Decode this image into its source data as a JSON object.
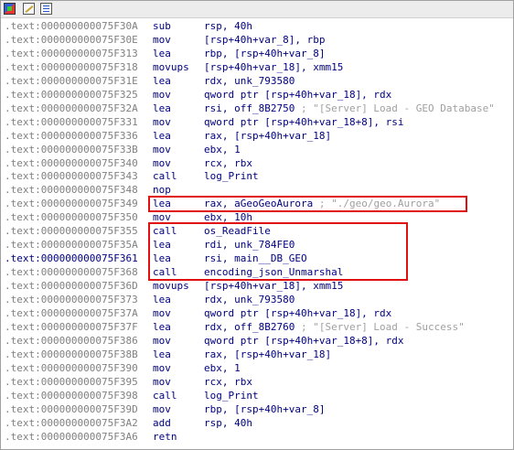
{
  "toolbar": {
    "icons": [
      "graph-view-icon",
      "edit-icon",
      "settings-icon"
    ]
  },
  "colors": {
    "address": "#808080",
    "current_address": "#000080",
    "mnemonic": "#000080",
    "comment": "#a0a0a0",
    "highlight_box": "#e01010"
  },
  "lines": [
    {
      "addr": ".text:000000000075F30A",
      "mn": "sub",
      "ops": "rsp, 40h",
      "cmt": ""
    },
    {
      "addr": ".text:000000000075F30E",
      "mn": "mov",
      "ops": "[rsp+40h+var_8], rbp",
      "cmt": ""
    },
    {
      "addr": ".text:000000000075F313",
      "mn": "lea",
      "ops": "rbp, [rsp+40h+var_8]",
      "cmt": ""
    },
    {
      "addr": ".text:000000000075F318",
      "mn": "movups",
      "ops": "[rsp+40h+var_18], xmm15",
      "cmt": ""
    },
    {
      "addr": ".text:000000000075F31E",
      "mn": "lea",
      "ops": "rdx, unk_793580",
      "cmt": ""
    },
    {
      "addr": ".text:000000000075F325",
      "mn": "mov",
      "ops": "qword ptr [rsp+40h+var_18], rdx",
      "cmt": ""
    },
    {
      "addr": ".text:000000000075F32A",
      "mn": "lea",
      "ops": "rsi, off_8B2750",
      "cmt": " ; \"[Server] Load - GEO Database\""
    },
    {
      "addr": ".text:000000000075F331",
      "mn": "mov",
      "ops": "qword ptr [rsp+40h+var_18+8], rsi",
      "cmt": ""
    },
    {
      "addr": ".text:000000000075F336",
      "mn": "lea",
      "ops": "rax, [rsp+40h+var_18]",
      "cmt": ""
    },
    {
      "addr": ".text:000000000075F33B",
      "mn": "mov",
      "ops": "ebx, 1",
      "cmt": ""
    },
    {
      "addr": ".text:000000000075F340",
      "mn": "mov",
      "ops": "rcx, rbx",
      "cmt": ""
    },
    {
      "addr": ".text:000000000075F343",
      "mn": "call",
      "ops": "log_Print",
      "cmt": ""
    },
    {
      "addr": ".text:000000000075F348",
      "mn": "nop",
      "ops": "",
      "cmt": ""
    },
    {
      "addr": ".text:000000000075F349",
      "mn": "lea",
      "ops": "rax, aGeoGeoAurora",
      "cmt": " ; \"./geo/geo.Aurora\""
    },
    {
      "addr": ".text:000000000075F350",
      "mn": "mov",
      "ops": "ebx, 10h",
      "cmt": ""
    },
    {
      "addr": ".text:000000000075F355",
      "mn": "call",
      "ops": "os_ReadFile",
      "cmt": ""
    },
    {
      "addr": ".text:000000000075F35A",
      "mn": "lea",
      "ops": "rdi, unk_784FE0",
      "cmt": ""
    },
    {
      "addr": ".text:000000000075F361",
      "mn": "lea",
      "ops": "rsi, main__DB_GEO",
      "cmt": ""
    },
    {
      "addr": ".text:000000000075F368",
      "mn": "call",
      "ops": "encoding_json_Unmarshal",
      "cmt": ""
    },
    {
      "addr": ".text:000000000075F36D",
      "mn": "movups",
      "ops": "[rsp+40h+var_18], xmm15",
      "cmt": ""
    },
    {
      "addr": ".text:000000000075F373",
      "mn": "lea",
      "ops": "rdx, unk_793580",
      "cmt": ""
    },
    {
      "addr": ".text:000000000075F37A",
      "mn": "mov",
      "ops": "qword ptr [rsp+40h+var_18], rdx",
      "cmt": ""
    },
    {
      "addr": ".text:000000000075F37F",
      "mn": "lea",
      "ops": "rdx, off_8B2760",
      "cmt": " ; \"[Server] Load - Success\""
    },
    {
      "addr": ".text:000000000075F386",
      "mn": "mov",
      "ops": "qword ptr [rsp+40h+var_18+8], rdx",
      "cmt": ""
    },
    {
      "addr": ".text:000000000075F38B",
      "mn": "lea",
      "ops": "rax, [rsp+40h+var_18]",
      "cmt": ""
    },
    {
      "addr": ".text:000000000075F390",
      "mn": "mov",
      "ops": "ebx, 1",
      "cmt": ""
    },
    {
      "addr": ".text:000000000075F395",
      "mn": "mov",
      "ops": "rcx, rbx",
      "cmt": ""
    },
    {
      "addr": ".text:000000000075F398",
      "mn": "call",
      "ops": "log_Print",
      "cmt": ""
    },
    {
      "addr": ".text:000000000075F39D",
      "mn": "mov",
      "ops": "rbp, [rsp+40h+var_8]",
      "cmt": ""
    },
    {
      "addr": ".text:000000000075F3A2",
      "mn": "add",
      "ops": "rsp, 40h",
      "cmt": ""
    },
    {
      "addr": ".text:000000000075F3A6",
      "mn": "retn",
      "ops": "",
      "cmt": ""
    }
  ]
}
